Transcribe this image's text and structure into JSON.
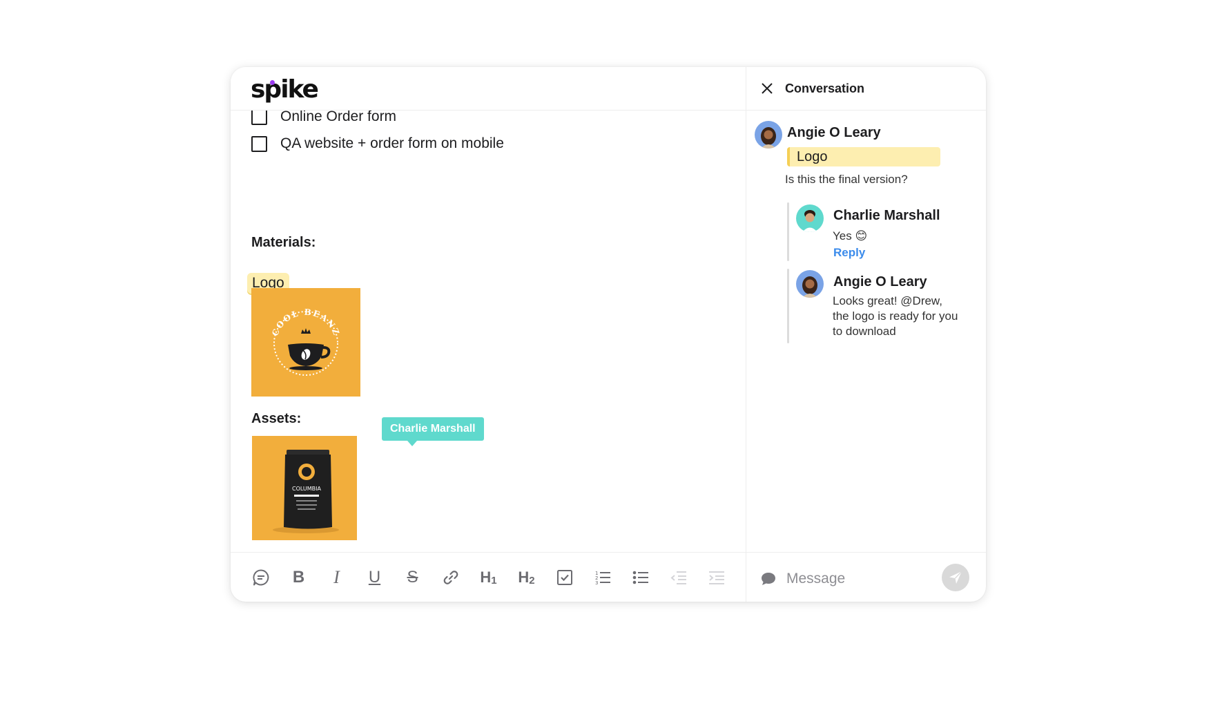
{
  "app": {
    "logo_text": "spike"
  },
  "editor": {
    "checklist": [
      {
        "label": "Online Order form",
        "checked": false
      },
      {
        "label": "QA website + order form on mobile",
        "checked": false
      }
    ],
    "materials_label": "Materials:",
    "materials_tag": "Logo",
    "logo_image": {
      "text": "COOL BEANZ",
      "bg_color": "#f2ae3c"
    },
    "assets_label": "Assets:",
    "package_image": {
      "text": "COLUMBIA",
      "bg_color": "#f2ae3c"
    },
    "cursor_tooltip": "Charlie Marshall"
  },
  "toolbar": {
    "items": [
      {
        "name": "comment",
        "icon": "comment-icon"
      },
      {
        "name": "bold",
        "label": "B"
      },
      {
        "name": "italic",
        "label": "I"
      },
      {
        "name": "underline",
        "label": "U"
      },
      {
        "name": "strikethrough",
        "label": "S"
      },
      {
        "name": "link",
        "icon": "link-icon"
      },
      {
        "name": "heading-1",
        "label": "H1"
      },
      {
        "name": "heading-2",
        "label": "H2"
      },
      {
        "name": "checklist",
        "icon": "checkbox-icon"
      },
      {
        "name": "numbered-list",
        "icon": "numbered-list-icon"
      },
      {
        "name": "bullet-list",
        "icon": "bullet-list-icon"
      },
      {
        "name": "outdent",
        "icon": "outdent-icon"
      },
      {
        "name": "indent",
        "icon": "indent-icon"
      }
    ]
  },
  "conversation": {
    "title": "Conversation",
    "thread": {
      "author": "Angie O Leary",
      "tag": "Logo",
      "text": "Is this the final version?"
    },
    "replies": [
      {
        "author": "Charlie Marshall",
        "text": "Yes",
        "emoji": "😊",
        "reply_label": "Reply"
      },
      {
        "author": "Angie O Leary",
        "text": "Looks great! @Drew, the logo is ready for you to download"
      }
    ],
    "message_placeholder": "Message"
  },
  "colors": {
    "accent_teal": "#5fd9cd",
    "highlight_yellow": "#fdeeb0",
    "link_blue": "#3b8beb",
    "brand_purple": "#9b3cf0"
  }
}
